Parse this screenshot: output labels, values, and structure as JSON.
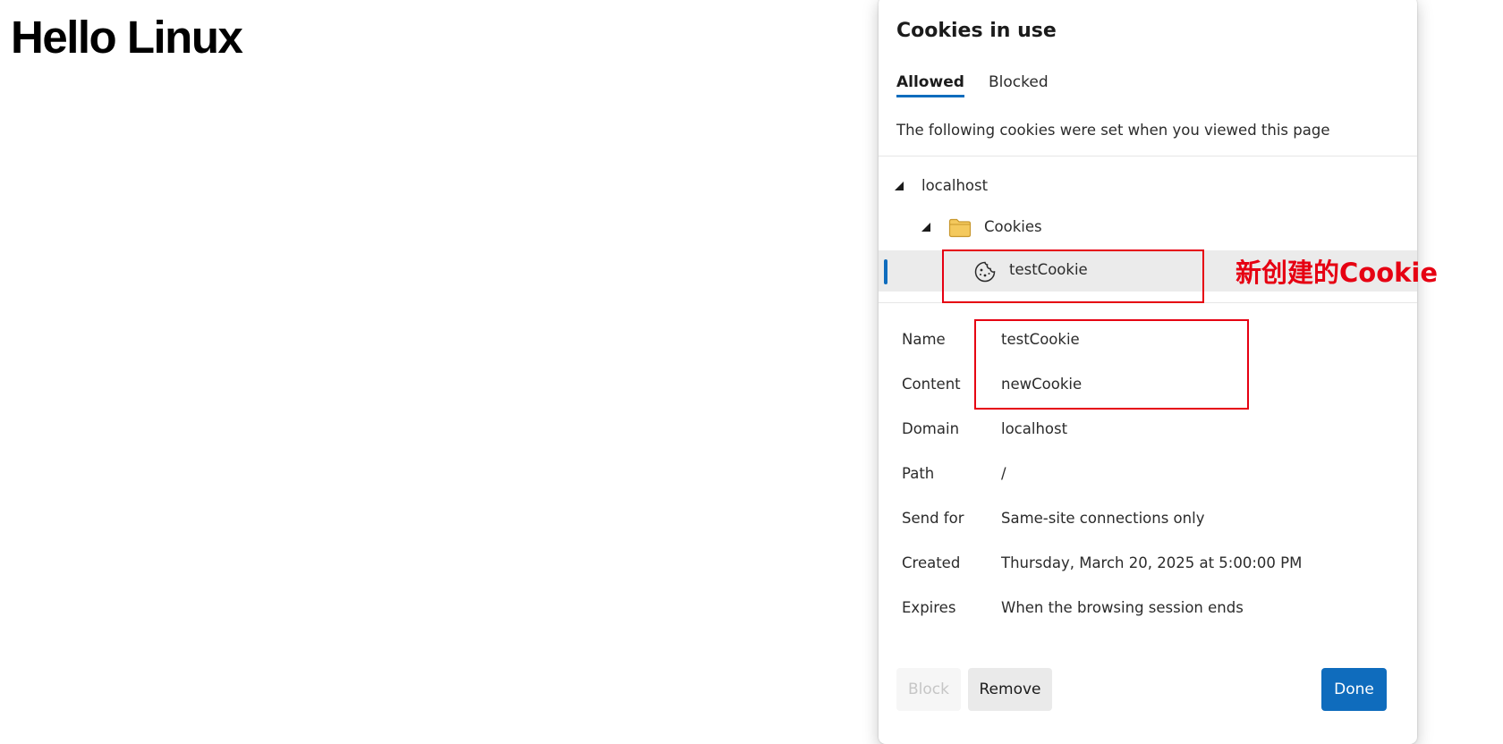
{
  "page": {
    "heading": "Hello Linux"
  },
  "dialog": {
    "title": "Cookies in use",
    "tabs": [
      {
        "label": "Allowed",
        "selected": true
      },
      {
        "label": "Blocked",
        "selected": false
      }
    ],
    "description": "The following cookies were set when you viewed this page",
    "tree": {
      "host": "localhost",
      "folder": "Cookies",
      "cookie": "testCookie"
    },
    "details": [
      {
        "label": "Name",
        "value": "testCookie"
      },
      {
        "label": "Content",
        "value": "newCookie"
      },
      {
        "label": "Domain",
        "value": "localhost"
      },
      {
        "label": "Path",
        "value": "/"
      },
      {
        "label": "Send for",
        "value": "Same-site connections only"
      },
      {
        "label": "Created",
        "value": "Thursday, March 20, 2025 at 5:00:00 PM"
      },
      {
        "label": "Expires",
        "value": "When the browsing session ends"
      }
    ],
    "buttons": {
      "block": "Block",
      "remove": "Remove",
      "done": "Done"
    }
  },
  "annotation": {
    "text": "新创建的Cookie",
    "color": "#e60012"
  },
  "colors": {
    "accent": "#0f6cbd",
    "folder": "#f4c95d"
  },
  "icons": {
    "folder": "folder-icon",
    "cookie": "cookie-icon",
    "caret": "caret-expanded-icon"
  }
}
